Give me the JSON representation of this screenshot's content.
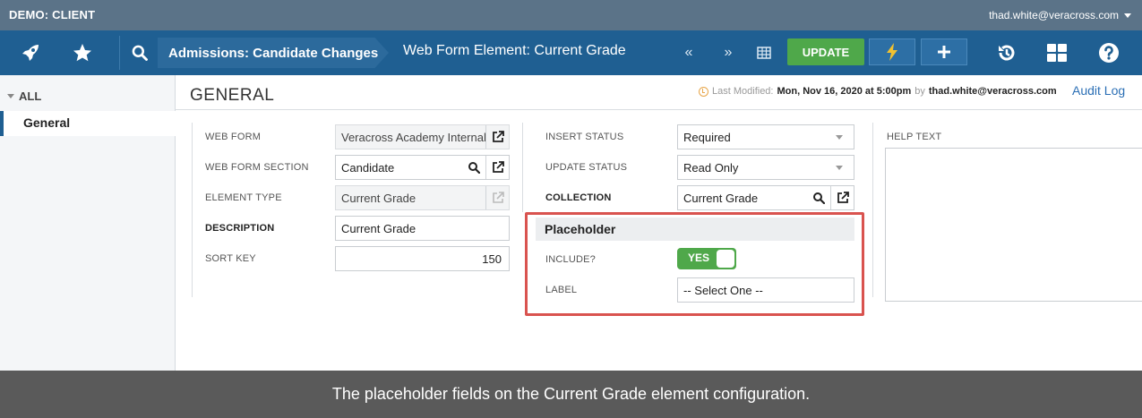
{
  "app": {
    "demo_label": "DEMO: CLIENT",
    "user_email": "thad.white@veracross.com"
  },
  "toolbar": {
    "breadcrumb": "Admissions: Candidate Changes",
    "subtitle": "Web Form Element: Current Grade",
    "prev_label": "«",
    "next_label": "»",
    "update_label": "UPDATE"
  },
  "sidebar": {
    "all_label": "ALL",
    "items": [
      {
        "label": "General",
        "active": true
      }
    ]
  },
  "header": {
    "title": "GENERAL",
    "last_modified_prefix": "Last Modified:",
    "last_modified_date": "Mon, Nov 16, 2020 at 5:00pm",
    "last_modified_by_word": "by",
    "last_modified_user": "thad.white@veracross.com",
    "audit_log": "Audit Log"
  },
  "form": {
    "web_form": {
      "label": "WEB FORM",
      "value": "Veracross Academy Internal"
    },
    "web_form_section": {
      "label": "WEB FORM SECTION",
      "value": "Candidate"
    },
    "element_type": {
      "label": "ELEMENT TYPE",
      "value": "Current Grade"
    },
    "description": {
      "label": "DESCRIPTION",
      "value": "Current Grade"
    },
    "sort_key": {
      "label": "SORT KEY",
      "value": "150"
    },
    "insert_status": {
      "label": "INSERT STATUS",
      "value": "Required"
    },
    "update_status": {
      "label": "UPDATE STATUS",
      "value": "Read Only"
    },
    "collection": {
      "label": "COLLECTION",
      "value": "Current Grade"
    },
    "help_text": {
      "label": "HELP TEXT",
      "value": ""
    }
  },
  "placeholder": {
    "heading": "Placeholder",
    "include": {
      "label": "INCLUDE?",
      "value": "YES",
      "on": true
    },
    "label_field": {
      "label": "LABEL",
      "value": "-- Select One --"
    }
  },
  "caption": "The placeholder fields on the Current Grade element configuration.",
  "colors": {
    "toolbar_bg": "#1f5f92",
    "top_strip_bg": "#5b7388",
    "update_green": "#4fa84a",
    "highlight_red": "#d9534f",
    "bolt_yellow": "#f2c230",
    "link_blue": "#2b6fb5"
  },
  "icons": {
    "launch": "rocket-icon",
    "favorites": "star-icon",
    "search": "search-icon",
    "grid_view": "table-grid-icon",
    "quick_action": "lightning-bolt-icon",
    "add": "plus-icon",
    "history": "history-icon",
    "apps": "apps-grid-icon",
    "help": "help-icon",
    "external": "external-link-icon",
    "clock": "clock-icon"
  }
}
